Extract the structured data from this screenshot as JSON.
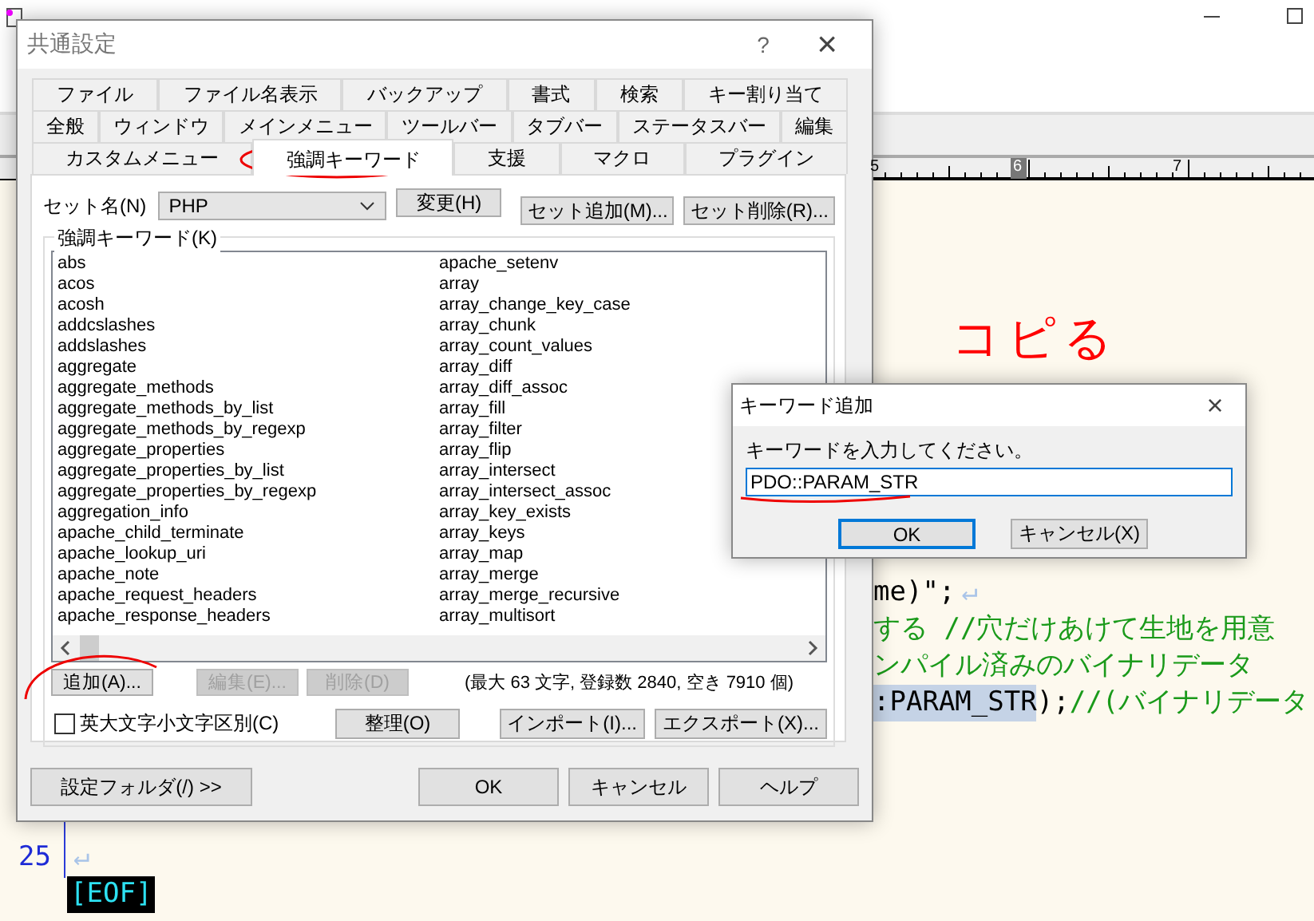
{
  "editor": {
    "ruler": [
      {
        "label": "5",
        "selected": false
      },
      {
        "label": "6",
        "selected": true
      },
      {
        "label": "7",
        "selected": false
      }
    ],
    "code_lines": [
      {
        "segments": [
          {
            "text": "me)\";",
            "kind": "code"
          },
          {
            "text": "↵",
            "kind": "eol"
          }
        ]
      },
      {
        "segments": [
          {
            "text": "する //穴だけあけて生地を用意",
            "kind": "comment"
          }
        ]
      },
      {
        "segments": [
          {
            "text": "ンパイル済みのバイナリデータ",
            "kind": "comment"
          }
        ]
      },
      {
        "segments": [
          {
            "text": ":PARAM_STR",
            "kind": "selected"
          },
          {
            "text": ");",
            "kind": "code"
          },
          {
            "text": "//(バイナリデータ",
            "kind": "comment"
          }
        ]
      }
    ],
    "numbered_lines": [
      {
        "number": "25",
        "eol": "↵"
      }
    ],
    "eof": "[EOF]"
  },
  "annotation": "コピる",
  "settings_dialog": {
    "title": "共通設定",
    "help": "?",
    "close": "×",
    "tab_rows": [
      [
        {
          "label": "ファイル",
          "selected": false
        },
        {
          "label": "ファイル名表示",
          "selected": false
        },
        {
          "label": "バックアップ",
          "selected": false
        },
        {
          "label": "書式",
          "selected": false
        },
        {
          "label": "検索",
          "selected": false
        },
        {
          "label": "キー割り当て",
          "selected": false
        }
      ],
      [
        {
          "label": "全般",
          "selected": false
        },
        {
          "label": "ウィンドウ",
          "selected": false
        },
        {
          "label": "メインメニュー",
          "selected": false
        },
        {
          "label": "ツールバー",
          "selected": false
        },
        {
          "label": "タブバー",
          "selected": false
        },
        {
          "label": "ステータスバー",
          "selected": false
        },
        {
          "label": "編集",
          "selected": false
        }
      ],
      [
        {
          "label": "カスタムメニュー",
          "selected": false
        },
        {
          "label": "強調キーワード",
          "selected": true
        },
        {
          "label": "支援",
          "selected": false
        },
        {
          "label": "マクロ",
          "selected": false
        },
        {
          "label": "プラグイン",
          "selected": false
        }
      ]
    ],
    "set_label": "セット名(N)",
    "set_value": "PHP",
    "set_buttons": [
      {
        "label": "変更(H)",
        "disabled": false
      },
      {
        "label": "セット追加(M)...",
        "disabled": false
      },
      {
        "label": "セット削除(R)...",
        "disabled": false
      }
    ],
    "group_label": "強調キーワード(K)",
    "keyword_columns": [
      [
        "abs",
        "acos",
        "acosh",
        "addcslashes",
        "addslashes",
        "aggregate",
        "aggregate_methods",
        "aggregate_methods_by_list",
        "aggregate_methods_by_regexp",
        "aggregate_properties",
        "aggregate_properties_by_list",
        "aggregate_properties_by_regexp",
        "aggregation_info",
        "apache_child_terminate",
        "apache_lookup_uri",
        "apache_note",
        "apache_request_headers",
        "apache_response_headers"
      ],
      [
        "apache_setenv",
        "array",
        "array_change_key_case",
        "array_chunk",
        "array_count_values",
        "array_diff",
        "array_diff_assoc",
        "array_fill",
        "array_filter",
        "array_flip",
        "array_intersect",
        "array_intersect_assoc",
        "array_key_exists",
        "array_keys",
        "array_map",
        "array_merge",
        "array_merge_recursive",
        "array_multisort"
      ]
    ],
    "edit_buttons": [
      {
        "label": "追加(A)...",
        "disabled": false
      },
      {
        "label": "編集(E)...",
        "disabled": true
      },
      {
        "label": "削除(D)",
        "disabled": true
      }
    ],
    "info": "(最大 63 文字, 登録数 2840, 空き 7910 個)",
    "case_checkbox": {
      "label": "英大文字小文字区別(C)",
      "checked": false
    },
    "tidy_button": "整理(O)",
    "io_buttons": [
      "インポート(I)...",
      "エクスポート(X)..."
    ],
    "folder_button": "設定フォルダ(/) >>",
    "footer_buttons": [
      "OK",
      "キャンセル",
      "ヘルプ"
    ]
  },
  "keyword_dialog": {
    "title": "キーワード追加",
    "close": "×",
    "prompt": "キーワードを入力してください。",
    "value": "PDO::PARAM_STR",
    "buttons": [
      {
        "label": "OK",
        "focused": true
      },
      {
        "label": "キャンセル(X)",
        "focused": false
      }
    ]
  }
}
